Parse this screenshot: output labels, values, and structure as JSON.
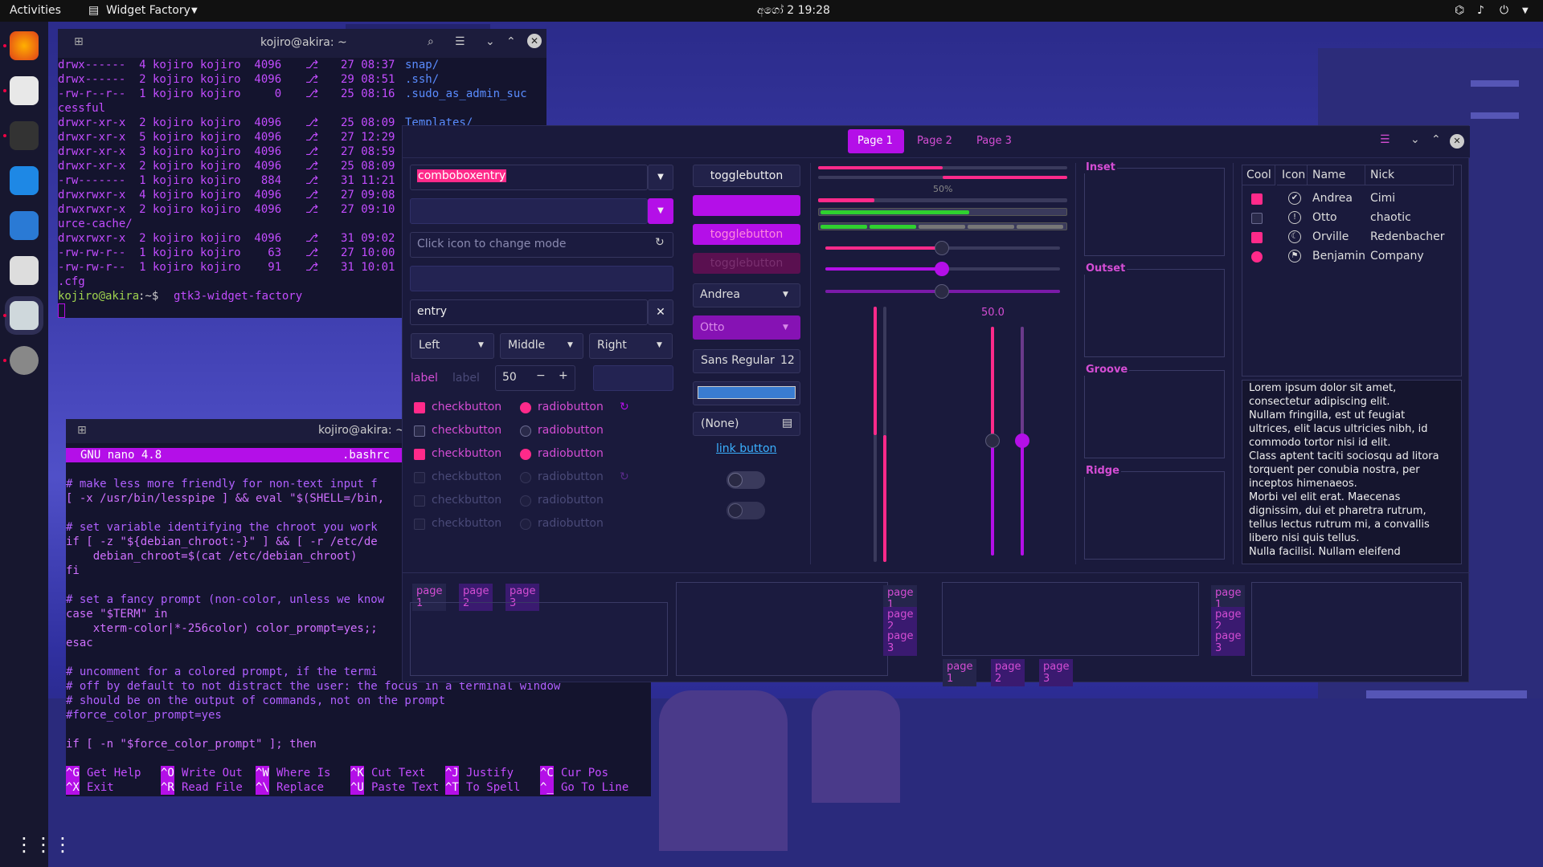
{
  "topbar": {
    "activities": "Activities",
    "app_name": "Widget Factory",
    "clock": "අගෝ 2  19:28"
  },
  "terminal": {
    "title": "kojiro@akira: ~",
    "lines": [
      "drwx------  4 kojiro kojiro  4096 ",
      "drwx------  2 kojiro kojiro  4096 ",
      "-rw-r--r--  1 kojiro kojiro     0 ",
      "cessful",
      "drwxr-xr-x  2 kojiro kojiro  4096 ",
      "drwxr-xr-x  5 kojiro kojiro  4096 ",
      "drwxr-xr-x  3 kojiro kojiro  4096 ",
      "drwxr-xr-x  2 kojiro kojiro  4096 ",
      "-rw-------  1 kojiro kojiro   884 ",
      "drwxrwxr-x  4 kojiro kojiro  4096 ",
      "drwxrwxr-x  2 kojiro kojiro  4096 ",
      "urce-cache/",
      "drwxrwxr-x  2 kojiro kojiro  4096 ",
      "-rw-rw-r--  1 kojiro kojiro    63 ",
      "-rw-rw-r--  1 kojiro kojiro    91 ",
      ".cfg"
    ],
    "dates": [
      "27 08:37",
      "29 08:51",
      "25 08:16",
      "",
      "25 08:09",
      "27 12:29",
      "27 08:59",
      "25 08:09",
      "31 11:21",
      "27 09:08",
      "27 09:10",
      "",
      "31 09:02",
      "27 10:00",
      "31 10:01",
      ""
    ],
    "names": [
      "snap/",
      ".ssh/",
      ".sudo_as_admin_suc",
      "",
      "Templates/",
      "",
      "",
      "",
      "",
      "",
      "",
      "",
      "",
      "",
      "",
      ""
    ],
    "prompt_user": "kojiro@akira",
    "prompt_path": ":~$ ",
    "prompt_cmd": "gtk3-widget-factory"
  },
  "nano": {
    "title": "kojiro@akira: ~",
    "version": "GNU nano 4.8",
    "file": ".bashrc",
    "lines": [
      "# make less more friendly for non-text input f",
      "[ -x /usr/bin/lesspipe ] && eval \"$(SHELL=/bin,",
      "",
      "# set variable identifying the chroot you work",
      "if [ -z \"${debian_chroot:-}\" ] && [ -r /etc/de",
      "    debian_chroot=$(cat /etc/debian_chroot)",
      "fi",
      "",
      "# set a fancy prompt (non-color, unless we know",
      "case \"$TERM\" in",
      "    xterm-color|*-256color) color_prompt=yes;;",
      "esac",
      "",
      "# uncomment for a colored prompt, if the termi",
      "# off by default to not distract the user: the focus in a terminal window",
      "# should be on the output of commands, not on the prompt",
      "#force_color_prompt=yes",
      "",
      "if [ -n \"$force_color_prompt\" ]; then"
    ],
    "shortcuts": [
      [
        "^G",
        "Get Help",
        "^O",
        "Write Out",
        "^W",
        "Where Is",
        "^K",
        "Cut Text",
        "^J",
        "Justify",
        "^C",
        "Cur Pos"
      ],
      [
        "^X",
        "Exit",
        "^R",
        "Read File",
        "^\\",
        "Replace",
        "^U",
        "Paste Text",
        "^T",
        "To Spell",
        "^_",
        "Go To Line"
      ]
    ]
  },
  "wf": {
    "header_tabs": [
      "Page 1",
      "Page 2",
      "Page 3"
    ],
    "comboboxentry": "comboboxentry",
    "entry_placeholder": "Click icon to change mode",
    "entry_value": "entry",
    "combo_left": "Left",
    "combo_middle": "Middle",
    "combo_right": "Right",
    "label1": "label",
    "label2": "label",
    "spin_value": "50",
    "check_label": "checkbutton",
    "radio_label": "radiobutton",
    "togglebutton": "togglebutton",
    "togglebutton2": "togglebutton",
    "togglebutton3": "togglebutton",
    "combo_andrea": "Andrea",
    "combo_otto": "Otto",
    "font_name": "Sans Regular",
    "font_size": "12",
    "file_none": "(None)",
    "link": "link button",
    "progress_label": "50%",
    "scale_value": "50.0",
    "frames": [
      "Inset",
      "Outset",
      "Groove",
      "Ridge"
    ],
    "tree_headers": [
      "Cool",
      "Icon",
      "Name",
      "Nick"
    ],
    "tree_rows": [
      {
        "name": "Andrea",
        "nick": "Cimi",
        "cool": true
      },
      {
        "name": "Otto",
        "nick": "chaotic",
        "cool": false
      },
      {
        "name": "Orville",
        "nick": "Redenbacher",
        "cool": true
      },
      {
        "name": "Benjamin",
        "nick": "Company",
        "cool": true
      }
    ],
    "lorem": [
      "Lorem ipsum dolor sit amet,",
      "consectetur adipiscing elit.",
      "Nullam fringilla, est ut feugiat",
      "ultrices, elit lacus ultricies nibh, id",
      "commodo tortor nisi id elit.",
      "Class aptent taciti sociosqu ad litora",
      "torquent per conubia nostra, per",
      "inceptos himenaeos.",
      "Morbi vel elit erat. Maecenas",
      "dignissim, dui et pharetra rutrum,",
      "tellus lectus rutrum mi, a convallis",
      "libero nisi quis tellus.",
      "Nulla facilisi. Nullam eleifend"
    ],
    "notebook_tabs": [
      "page 1",
      "page 2",
      "page 3"
    ],
    "progress": 0.5,
    "accent": "#b40fe8",
    "pink": "#ff2a8a",
    "green": "#2fd12f"
  }
}
